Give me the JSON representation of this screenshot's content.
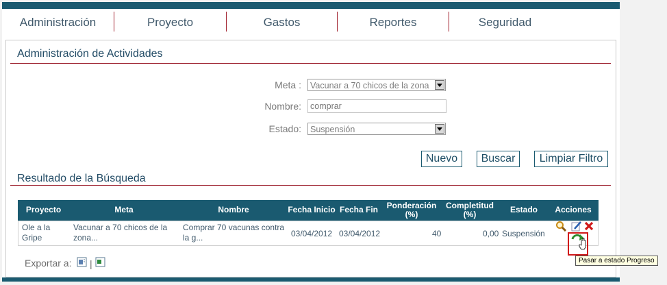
{
  "nav": {
    "tabs": [
      {
        "label": "Administración"
      },
      {
        "label": "Proyecto"
      },
      {
        "label": "Gastos"
      },
      {
        "label": "Reportes"
      },
      {
        "label": "Seguridad"
      }
    ]
  },
  "filter": {
    "title": "Administración de Actividades",
    "meta_label": "Meta :",
    "meta_value": "Vacunar a 70 chicos de la zona",
    "nombre_label": "Nombre:",
    "nombre_value": "comprar",
    "estado_label": "Estado:",
    "estado_value": "Suspensión",
    "buttons": {
      "nuevo": "Nuevo",
      "buscar": "Buscar",
      "limpiar": "Limpiar Filtro"
    }
  },
  "results": {
    "title": "Resultado de la Búsqueda",
    "columns": [
      "Proyecto",
      "Meta",
      "Nombre",
      "Fecha Inicio",
      "Fecha Fin",
      "Ponderación (%)",
      "Completitud (%)",
      "Estado",
      "Acciones"
    ],
    "rows": [
      {
        "proyecto": "Ole a la Gripe",
        "meta": "Vacunar a 70 chicos de la zona...",
        "nombre": "Comprar 70 vacunas contra la g...",
        "fecha_inicio": "03/04/2012",
        "fecha_fin": "03/04/2012",
        "ponderacion": "40",
        "completitud": "0,00",
        "estado": "Suspensión"
      }
    ]
  },
  "tooltip": "Pasar a estado Progreso",
  "export": {
    "label": "Exportar a:",
    "separator": "|"
  },
  "icons": [
    "search-icon",
    "edit-icon",
    "delete-icon",
    "change-state-icon",
    "excel-export-icon",
    "csv-export-icon"
  ],
  "colors": {
    "header": "#1a5a70",
    "accent_rule": "#9b1c2a"
  }
}
